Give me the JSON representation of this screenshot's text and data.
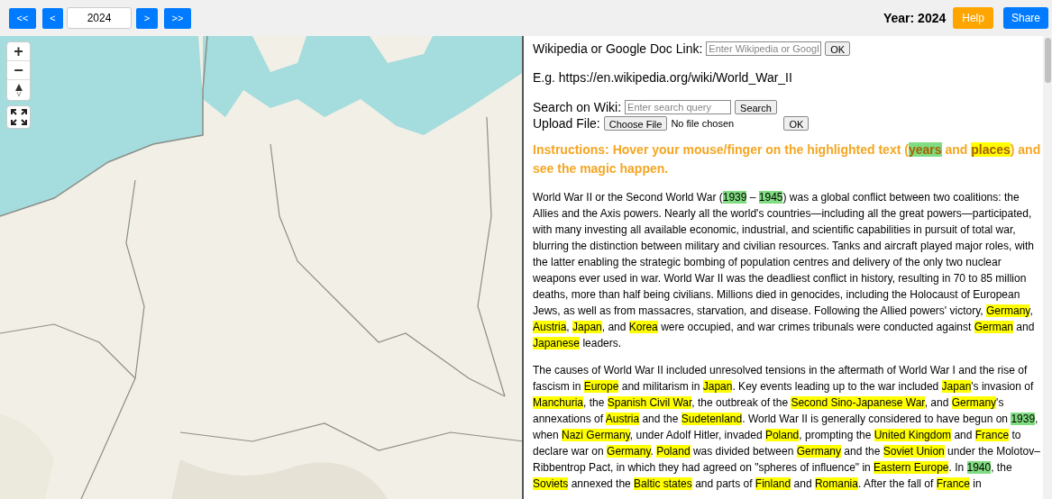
{
  "toolbar": {
    "nav_buttons": [
      "<<",
      "<"
    ],
    "year_value": "2024",
    "nav_buttons_after": [
      ">",
      ">>"
    ],
    "year_label": "Year: 2024",
    "help": "Help",
    "share": "Share"
  },
  "map": {
    "kind": "picture",
    "controls": [
      "+",
      "−"
    ]
  },
  "panel": {
    "link_label": "Wikipedia or Google Doc Link:",
    "link_placeholder": "Enter Wikipedia or Googl",
    "link_ok": "OK",
    "example": "E.g. https://en.wikipedia.org/wiki/World_War_II",
    "search_label": "Search on Wiki:",
    "search_placeholder": "Enter search query",
    "search_button": "Search",
    "upload_label": "Upload File:",
    "choose_file": "Choose File",
    "file_status": "No file chosen",
    "upload_ok": "OK",
    "instructions": [
      "Instructions: Hover your mouse/finger on the highlighted text (",
      {
        "text": "years",
        "kind": "year"
      },
      " and ",
      {
        "text": "places",
        "kind": "place"
      },
      ") and see the magic happen."
    ],
    "paragraphs": [
      [
        "World War II or the Second World War (",
        {
          "text": "1939",
          "kind": "year"
        },
        " – ",
        {
          "text": "1945",
          "kind": "year"
        },
        ") was a global conflict between two coalitions: the Allies and the Axis powers. Nearly all the world's countries—including all the great powers—participated, with many investing all available economic, industrial, and scientific capabilities in pursuit of total war, blurring the distinction between military and civilian resources. Tanks and aircraft played major roles, with the latter enabling the strategic bombing of population centres and delivery of the only two nuclear weapons ever used in war. World War II was the deadliest conflict in history, resulting in 70 to 85 million deaths, more than half being civilians. Millions died in genocides, including the Holocaust of European Jews, as well as from massacres, starvation, and disease. Following the Allied powers' victory, ",
        {
          "text": "Germany",
          "kind": "place"
        },
        ", ",
        {
          "text": "Austria",
          "kind": "place"
        },
        ", ",
        {
          "text": "Japan",
          "kind": "place"
        },
        ", and ",
        {
          "text": "Korea",
          "kind": "place"
        },
        " were occupied, and war crimes tribunals were conducted against ",
        {
          "text": "German",
          "kind": "place"
        },
        " and ",
        {
          "text": "Japanese",
          "kind": "place"
        },
        " leaders."
      ],
      [
        "The causes of World War II included unresolved tensions in the aftermath of World War I and the rise of fascism in ",
        {
          "text": "Europe",
          "kind": "place"
        },
        " and militarism in ",
        {
          "text": "Japan",
          "kind": "place"
        },
        ". Key events leading up to the war included ",
        {
          "text": "Japan",
          "kind": "place"
        },
        "'s invasion of ",
        {
          "text": "Manchuria",
          "kind": "place"
        },
        ", the ",
        {
          "text": "Spanish Civil War",
          "kind": "place"
        },
        ", the outbreak of the ",
        {
          "text": "Second Sino-Japanese War",
          "kind": "place"
        },
        ", and ",
        {
          "text": "Germany",
          "kind": "place"
        },
        "'s annexations of ",
        {
          "text": "Austria",
          "kind": "place"
        },
        " and the ",
        {
          "text": "Sudetenland",
          "kind": "place"
        },
        ". World War II is generally considered to have begun on ",
        {
          "text": "1939",
          "kind": "year"
        },
        ", when ",
        {
          "text": "Nazi Germany",
          "kind": "place"
        },
        ", under Adolf Hitler, invaded ",
        {
          "text": "Poland",
          "kind": "place"
        },
        ", prompting the ",
        {
          "text": "United Kingdom",
          "kind": "place"
        },
        " and ",
        {
          "text": "France",
          "kind": "place"
        },
        " to declare war on ",
        {
          "text": "Germany",
          "kind": "place"
        },
        ". ",
        {
          "text": "Poland",
          "kind": "place"
        },
        " was divided between ",
        {
          "text": "Germany",
          "kind": "place"
        },
        " and the ",
        {
          "text": "Soviet Union",
          "kind": "place"
        },
        " under the Molotov–Ribbentrop Pact, in which they had agreed on \"spheres of influence\" in ",
        {
          "text": "Eastern Europe",
          "kind": "place"
        },
        ". In ",
        {
          "text": "1940",
          "kind": "year"
        },
        ", the ",
        {
          "text": "Soviets",
          "kind": "place"
        },
        " annexed the ",
        {
          "text": "Baltic states",
          "kind": "place"
        },
        " and parts of ",
        {
          "text": "Finland",
          "kind": "place"
        },
        " and ",
        {
          "text": "Romania",
          "kind": "place"
        },
        ". After the fall of ",
        {
          "text": "France",
          "kind": "place"
        },
        " in"
      ]
    ]
  }
}
